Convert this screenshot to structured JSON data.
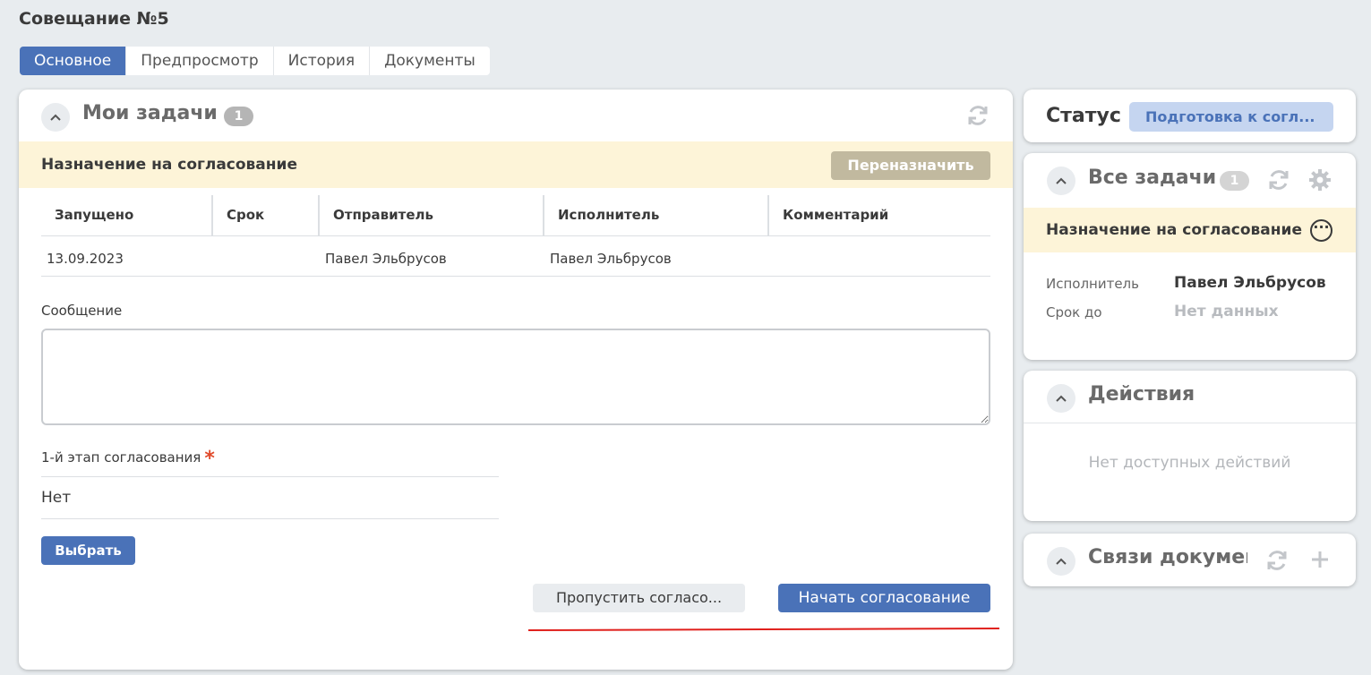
{
  "page": {
    "title": "Совещание №5"
  },
  "tabs": [
    {
      "label": "Основное",
      "active": true
    },
    {
      "label": "Предпросмотр",
      "active": false
    },
    {
      "label": "История",
      "active": false
    },
    {
      "label": "Документы",
      "active": false
    }
  ],
  "my_tasks": {
    "title": "Мои задачи",
    "count": "1",
    "task_title": "Назначение на согласование",
    "reassign_label": "Переназначить",
    "table": {
      "headers": [
        "Запущено",
        "Срок",
        "Отправитель",
        "Исполнитель",
        "Комментарий"
      ],
      "rows": [
        {
          "started": "13.09.2023",
          "deadline": "",
          "sender": "Павел Эльбрусов",
          "executor": "Павел Эльбрусов",
          "comment": ""
        }
      ]
    },
    "message_label": "Сообщение",
    "message_value": "",
    "stage_label": "1-й этап согласования",
    "required_mark": "*",
    "stage_value": "Нет",
    "choose_label": "Выбрать",
    "skip_label": "Пропустить согласо...",
    "start_label": "Начать согласование"
  },
  "status": {
    "label": "Статус",
    "value": "Подготовка к согл..."
  },
  "all_tasks": {
    "title": "Все задачи",
    "count": "1",
    "task_title": "Назначение на согласование",
    "more_glyph": "···",
    "executor_key": "Исполнитель",
    "executor_value": "Павел Эльбрусов",
    "deadline_key": "Срок до",
    "deadline_value": "Нет данных"
  },
  "actions": {
    "title": "Действия",
    "empty_text": "Нет доступных действий"
  },
  "links": {
    "title": "Связи докумен"
  },
  "icons": {
    "collapse": "chevron-up-icon",
    "refresh": "refresh-icon",
    "settings": "gear-icon",
    "add": "plus-icon",
    "more": "more-horizontal-icon"
  },
  "colors": {
    "primary": "#4a72b8",
    "task_band": "#fdf4d8",
    "reassign": "#c1b99f",
    "status_badge_bg": "#c5d5f0",
    "required": "#e04a2b",
    "annotation_line": "#e0201c"
  }
}
